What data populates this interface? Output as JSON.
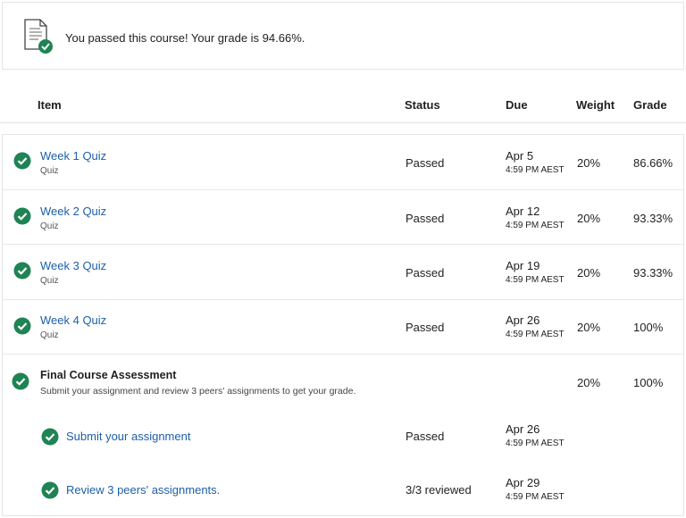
{
  "banner": {
    "message": "You passed this course! Your grade is 94.66%."
  },
  "table": {
    "headers": {
      "item": "Item",
      "status": "Status",
      "due": "Due",
      "weight": "Weight",
      "grade": "Grade"
    },
    "rows": [
      {
        "title": "Week 1 Quiz",
        "type": "Quiz",
        "status": "Passed",
        "due_date": "Apr 5",
        "due_time": "4:59 PM AEST",
        "weight": "20%",
        "grade": "86.66%"
      },
      {
        "title": "Week 2 Quiz",
        "type": "Quiz",
        "status": "Passed",
        "due_date": "Apr 12",
        "due_time": "4:59 PM AEST",
        "weight": "20%",
        "grade": "93.33%"
      },
      {
        "title": "Week 3 Quiz",
        "type": "Quiz",
        "status": "Passed",
        "due_date": "Apr 19",
        "due_time": "4:59 PM AEST",
        "weight": "20%",
        "grade": "93.33%"
      },
      {
        "title": "Week 4 Quiz",
        "type": "Quiz",
        "status": "Passed",
        "due_date": "Apr 26",
        "due_time": "4:59 PM AEST",
        "weight": "20%",
        "grade": "100%"
      }
    ],
    "final": {
      "title": "Final Course Assessment",
      "description": "Submit your assignment and review 3 peers' assignments to get your grade.",
      "weight": "20%",
      "grade": "100%",
      "subitems": [
        {
          "title": "Submit your assignment",
          "status": "Passed",
          "due_date": "Apr 26",
          "due_time": "4:59 PM AEST"
        },
        {
          "title": "Review 3 peers' assignments.",
          "status": "3/3 reviewed",
          "due_date": "Apr 29",
          "due_time": "4:59 PM AEST"
        }
      ]
    }
  },
  "colors": {
    "check_green": "#1f8354",
    "link_blue": "#1d5fa8"
  }
}
